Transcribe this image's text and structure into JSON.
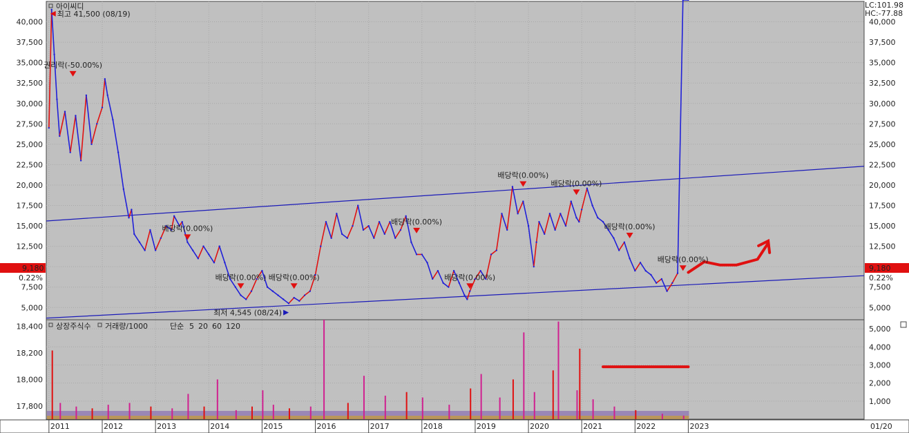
{
  "chart_data": [
    {
      "type": "line",
      "title": "아이씨디",
      "indicator_right": [
        "LC:101.98",
        "HC:-77.88"
      ],
      "current_price_label": "9,180",
      "current_change_label": "0.22%",
      "yticks": [
        "40,000",
        "37,500",
        "35,000",
        "32,500",
        "30,000",
        "27,500",
        "25,000",
        "22,500",
        "20,000",
        "17,500",
        "15,000",
        "12,500",
        "10,000",
        "7,500",
        "5,000"
      ],
      "ytick_values": [
        40000,
        37500,
        35000,
        32500,
        30000,
        27500,
        25000,
        22500,
        20000,
        17500,
        15000,
        12500,
        10000,
        7500,
        5000
      ],
      "ylim": [
        3500,
        42500
      ],
      "xticks": [
        "2011",
        "2012",
        "2013",
        "2014",
        "2015",
        "2016",
        "2017",
        "2018",
        "2019",
        "2020",
        "2021",
        "2022",
        "2023"
      ],
      "x_right_label": "01/20",
      "xlim": [
        2010.95,
        2026.3
      ],
      "price_series": {
        "name": "price",
        "x": [
          2011.0,
          2011.05,
          2011.1,
          2011.15,
          2011.2,
          2011.3,
          2011.4,
          2011.5,
          2011.6,
          2011.7,
          2011.8,
          2011.9,
          2012.0,
          2012.05,
          2012.1,
          2012.2,
          2012.3,
          2012.4,
          2012.5,
          2012.55,
          2012.6,
          2012.7,
          2012.8,
          2012.9,
          2013.0,
          2013.1,
          2013.2,
          2013.3,
          2013.35,
          2013.45,
          2013.5,
          2013.6,
          2013.7,
          2013.8,
          2013.9,
          2014.0,
          2014.1,
          2014.2,
          2014.3,
          2014.4,
          2014.5,
          2014.6,
          2014.7,
          2014.8,
          2014.9,
          2015.0,
          2015.1,
          2015.2,
          2015.3,
          2015.4,
          2015.5,
          2015.6,
          2015.7,
          2015.8,
          2015.9,
          2016.0,
          2016.1,
          2016.2,
          2016.3,
          2016.4,
          2016.5,
          2016.6,
          2016.7,
          2016.8,
          2016.9,
          2017.0,
          2017.1,
          2017.2,
          2017.3,
          2017.4,
          2017.5,
          2017.6,
          2017.7,
          2017.8,
          2017.9,
          2018.0,
          2018.1,
          2018.2,
          2018.3,
          2018.4,
          2018.5,
          2018.6,
          2018.7,
          2018.8,
          2018.85,
          2018.9,
          2019.0,
          2019.1,
          2019.2,
          2019.3,
          2019.4,
          2019.5,
          2019.6,
          2019.7,
          2019.8,
          2019.9,
          2020.0,
          2020.1,
          2020.15,
          2020.2,
          2020.3,
          2020.4,
          2020.5,
          2020.6,
          2020.7,
          2020.8,
          2020.9,
          2020.95,
          2021.0,
          2021.1,
          2021.2,
          2021.3,
          2021.4,
          2021.5,
          2021.6,
          2021.7,
          2021.8,
          2021.9,
          2022.0,
          2022.1,
          2022.2,
          2022.3,
          2022.4,
          2022.5,
          2022.6,
          2022.7,
          2022.8,
          2022.9,
          2023.0
        ],
        "y": [
          27000,
          41500,
          36000,
          30500,
          26000,
          29000,
          24000,
          28500,
          23000,
          31000,
          25000,
          27500,
          29500,
          33000,
          31000,
          28000,
          24000,
          19500,
          16000,
          17000,
          14000,
          13000,
          12000,
          14500,
          12000,
          13500,
          15000,
          14500,
          16200,
          15000,
          15500,
          13000,
          12000,
          11000,
          12500,
          11500,
          10500,
          12500,
          10500,
          8500,
          7500,
          6500,
          6000,
          7000,
          8500,
          9500,
          7500,
          7000,
          6500,
          6000,
          5500,
          6200,
          5800,
          6500,
          7000,
          9000,
          12500,
          15500,
          13500,
          16500,
          14000,
          13500,
          15000,
          17500,
          14500,
          15000,
          13500,
          15500,
          14000,
          15500,
          13500,
          14500,
          16200,
          13000,
          11500,
          11500,
          10500,
          8500,
          9500,
          8000,
          7500,
          9500,
          8000,
          6500,
          6000,
          7000,
          8500,
          9500,
          8500,
          11500,
          12000,
          16500,
          14500,
          19800,
          16500,
          18000,
          15000,
          10000,
          13000,
          15500,
          14000,
          16500,
          14500,
          16500,
          15000,
          18000,
          16000,
          15500,
          17000,
          19600,
          17500,
          16000,
          15500,
          14500,
          13500,
          12000,
          13000,
          11000,
          9500,
          10500,
          9500,
          9000,
          8000,
          8500,
          7000,
          8000,
          9200
        ],
        "color": "#1f1fd8",
        "alt_color": "#e01010"
      },
      "annotations": [
        {
          "text": "최고 41,500 (08/19)",
          "x": 2011.05,
          "y": 41500,
          "color": "#e01010"
        },
        {
          "text": "최저 4,545 (08/24)",
          "x": 2015.45,
          "y": 4545,
          "color": "#1a1ab8"
        }
      ],
      "events": [
        {
          "text": "권리락(-50.00%)",
          "x": 2011.45,
          "y": 33200
        },
        {
          "text": "배당락(0.00%)",
          "x": 2013.6,
          "y": 13200
        },
        {
          "text": "배당락(0.00%)",
          "x": 2014.6,
          "y": 7200
        },
        {
          "text": "배당락(0.00%)",
          "x": 2015.6,
          "y": 7200
        },
        {
          "text": "배당락(0.00%)",
          "x": 2017.9,
          "y": 14000
        },
        {
          "text": "배당락(0.00%)",
          "x": 2018.9,
          "y": 7200
        },
        {
          "text": "배당락(0.00%)",
          "x": 2019.9,
          "y": 19700
        },
        {
          "text": "배당락(0.00%)",
          "x": 2020.9,
          "y": 18700
        },
        {
          "text": "배당락(0.00%)",
          "x": 2021.9,
          "y": 13400
        },
        {
          "text": "배당락(0.00%)",
          "x": 2022.9,
          "y": 9400
        }
      ],
      "trendlines": [
        {
          "from": [
            2010.95,
            15600
          ],
          "to": [
            2026.3,
            22300
          ],
          "color": "#1a1ab8"
        },
        {
          "from": [
            2010.95,
            3700
          ],
          "to": [
            2026.3,
            8900
          ],
          "color": "#1a1ab8"
        }
      ],
      "drawing_arrow": {
        "points": [
          [
            2023.0,
            9300
          ],
          [
            2023.3,
            10600
          ],
          [
            2023.6,
            10200
          ],
          [
            2023.9,
            10200
          ],
          [
            2024.3,
            10900
          ],
          [
            2024.5,
            12900
          ]
        ],
        "color": "#e01010"
      }
    },
    {
      "type": "bar",
      "legend": [
        {
          "text": "상장주식수",
          "color": "#e0308a"
        },
        {
          "text": "거래량/1000",
          "color": "#20a0a0"
        },
        {
          "text": "단순",
          "color": "#e0308a"
        },
        {
          "text": "5",
          "color": "#e0308a"
        },
        {
          "text": "20",
          "color": "#e0b000"
        },
        {
          "text": "60",
          "color": "#20a020"
        },
        {
          "text": "120",
          "color": "#808080"
        }
      ],
      "left_yticks": [
        "18,400",
        "18,200",
        "18,000",
        "17,800"
      ],
      "left_ytick_values": [
        18400,
        18200,
        18000,
        17800
      ],
      "left_ylim": [
        17700,
        18450
      ],
      "right_yticks": [
        "5,000",
        "4,000",
        "3,000",
        "2,000",
        "1,000"
      ],
      "right_ytick_values": [
        5000,
        4000,
        3000,
        2000,
        1000
      ],
      "right_ylim": [
        0,
        5500
      ],
      "volume_x": [
        2011.05,
        2011.2,
        2011.5,
        2011.8,
        2012.1,
        2012.5,
        2012.9,
        2013.3,
        2013.6,
        2013.9,
        2014.15,
        2014.5,
        2014.8,
        2015.0,
        2015.2,
        2015.5,
        2015.9,
        2016.15,
        2016.6,
        2016.9,
        2017.3,
        2017.7,
        2018.0,
        2018.5,
        2018.9,
        2019.1,
        2019.45,
        2019.7,
        2019.9,
        2020.1,
        2020.45,
        2020.55,
        2020.9,
        2020.95,
        2021.2,
        2021.6,
        2022.0,
        2022.5,
        2022.9
      ],
      "volume": [
        3800,
        900,
        700,
        600,
        800,
        900,
        700,
        600,
        1400,
        700,
        2200,
        500,
        700,
        1600,
        800,
        600,
        700,
        5500,
        900,
        2400,
        1300,
        1500,
        1200,
        800,
        1700,
        2500,
        1200,
        2200,
        4800,
        1500,
        2700,
        5400,
        1600,
        3900,
        1100,
        700,
        500,
        300,
        200
      ],
      "drawing_line": {
        "from": [
          2021.4,
          2900
        ],
        "to": [
          2023.0,
          2900
        ],
        "color": "#e01010"
      }
    }
  ]
}
